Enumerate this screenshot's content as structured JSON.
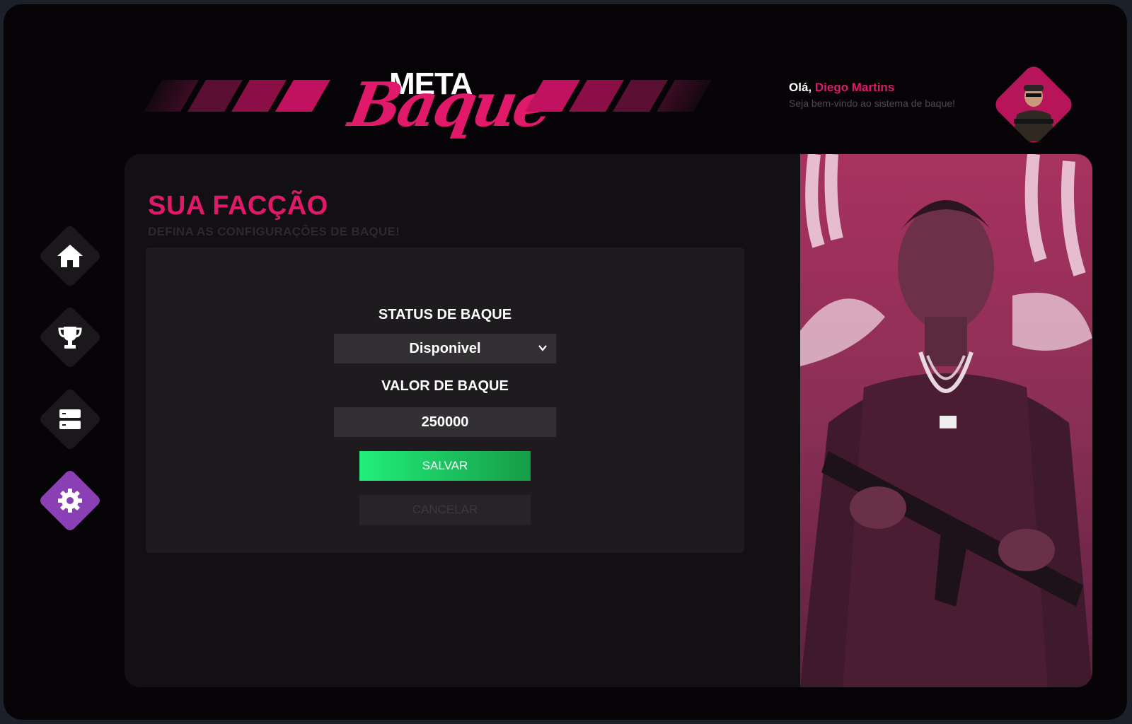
{
  "logo": {
    "top_text": "META",
    "script_text": "Baque"
  },
  "user": {
    "greeting": "Olá,",
    "name": "Diego Martins",
    "welcome": "Seja bem-vindo ao sistema de baque!"
  },
  "sidebar": {
    "items": [
      {
        "icon": "home-icon",
        "active": false
      },
      {
        "icon": "trophy-icon",
        "active": false
      },
      {
        "icon": "server-icon",
        "active": false
      },
      {
        "icon": "gear-icon",
        "active": true
      }
    ]
  },
  "page": {
    "title": "SUA FACÇÃO",
    "subtitle": "DEFINA AS CONFIGURAÇÕES DE BAQUE!"
  },
  "form": {
    "status_label": "STATUS DE BAQUE",
    "status_value": "Disponivel",
    "value_label": "VALOR DE BAQUE",
    "value_value": "250000",
    "save_label": "SALVAR",
    "cancel_label": "CANCELAR"
  },
  "colors": {
    "accent": "#e0196b",
    "active_nav": "#8a3fb5",
    "save_start": "#22ee7a",
    "save_end": "#169c47",
    "background": "#060406",
    "panel": "#121012"
  }
}
